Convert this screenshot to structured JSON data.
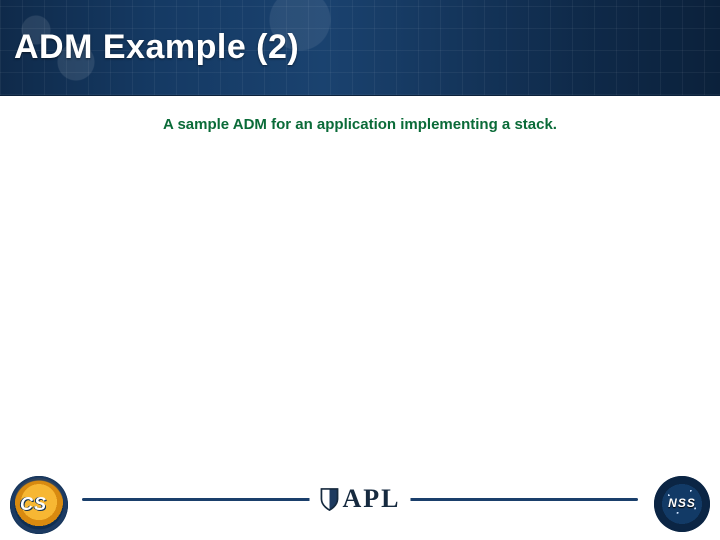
{
  "header": {
    "title": "ADM Example (2)"
  },
  "body": {
    "subtitle": "A sample ADM for an application implementing a stack."
  },
  "footer": {
    "left_logo_label": "CS",
    "center_logo_label": "APL",
    "right_logo_label": "NSS"
  }
}
